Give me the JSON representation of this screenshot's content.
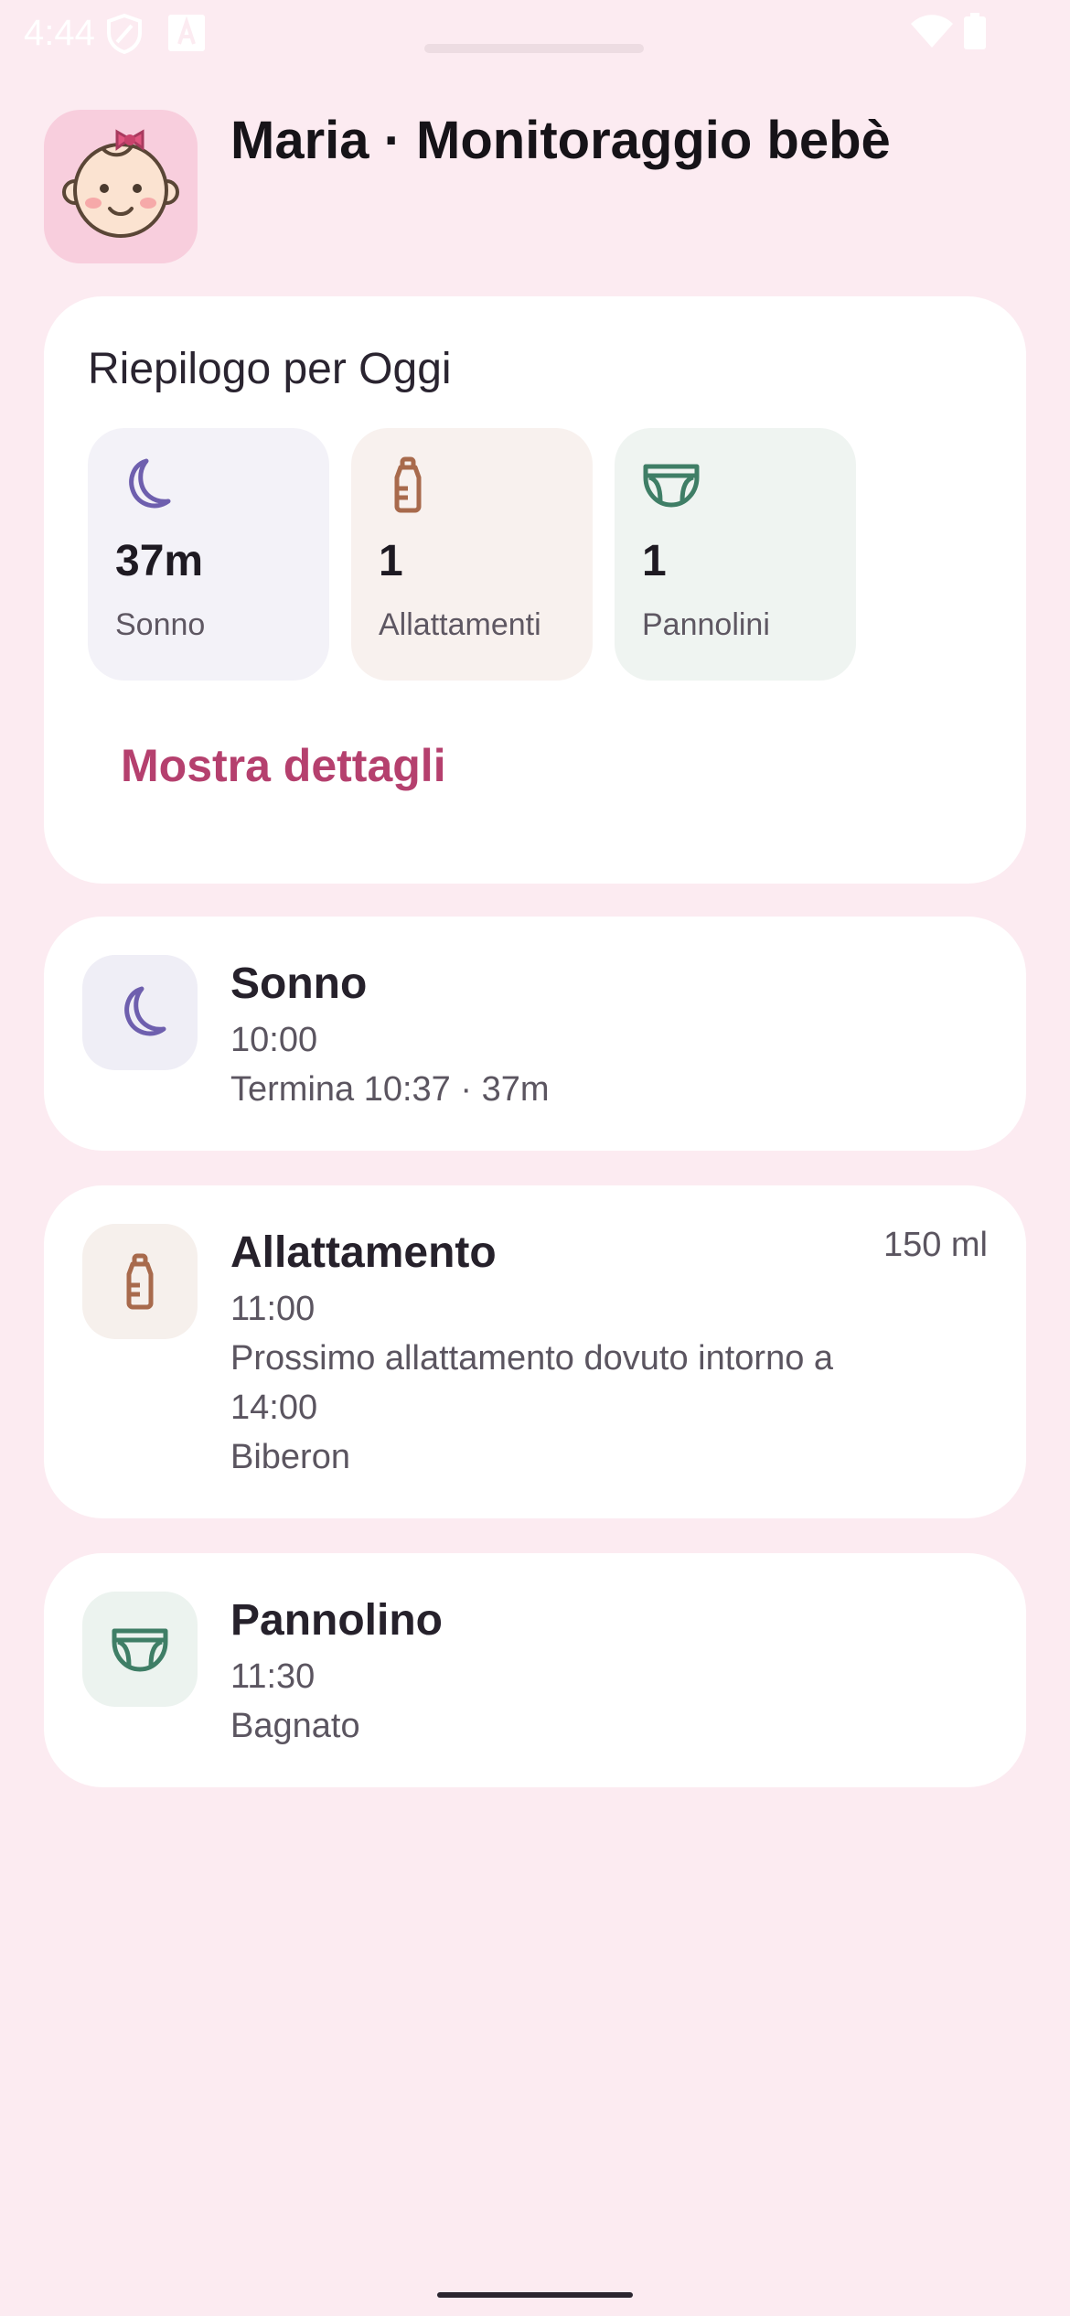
{
  "status_bar": {
    "time": "4:44",
    "icons": [
      "shield-icon",
      "font-a-icon",
      "wifi-icon",
      "battery-icon"
    ]
  },
  "header": {
    "title": "Maria · Monitoraggio bebè",
    "avatar_icon": "baby-face-icon"
  },
  "summary": {
    "title": "Riepilogo per Oggi",
    "tiles": [
      {
        "icon": "moon-icon",
        "value": "37m",
        "label": "Sonno",
        "color": "#6E5FAE"
      },
      {
        "icon": "bottle-icon",
        "value": "1",
        "label": "Allattamenti",
        "color": "#A86A4C"
      },
      {
        "icon": "diaper-icon",
        "value": "1",
        "label": "Pannolini",
        "color": "#3F7E66"
      }
    ],
    "details_label": "Mostra dettagli"
  },
  "events": [
    {
      "icon": "moon-icon",
      "title": "Sonno",
      "lines": [
        "10:00",
        "Termina 10:37 · 37m"
      ],
      "amount": ""
    },
    {
      "icon": "bottle-icon",
      "title": "Allattamento",
      "lines": [
        "11:00",
        "Prossimo allattamento dovuto intorno a",
        "14:00",
        "Biberon"
      ],
      "amount": "150 ml"
    },
    {
      "icon": "diaper-icon",
      "title": "Pannolino",
      "lines": [
        "11:30",
        "Bagnato"
      ],
      "amount": ""
    }
  ],
  "colors": {
    "background": "#FCEBF1",
    "accent": "#B5406E",
    "sleep": "#6E5FAE",
    "feeding": "#A86A4C",
    "diaper": "#3F7E66"
  }
}
